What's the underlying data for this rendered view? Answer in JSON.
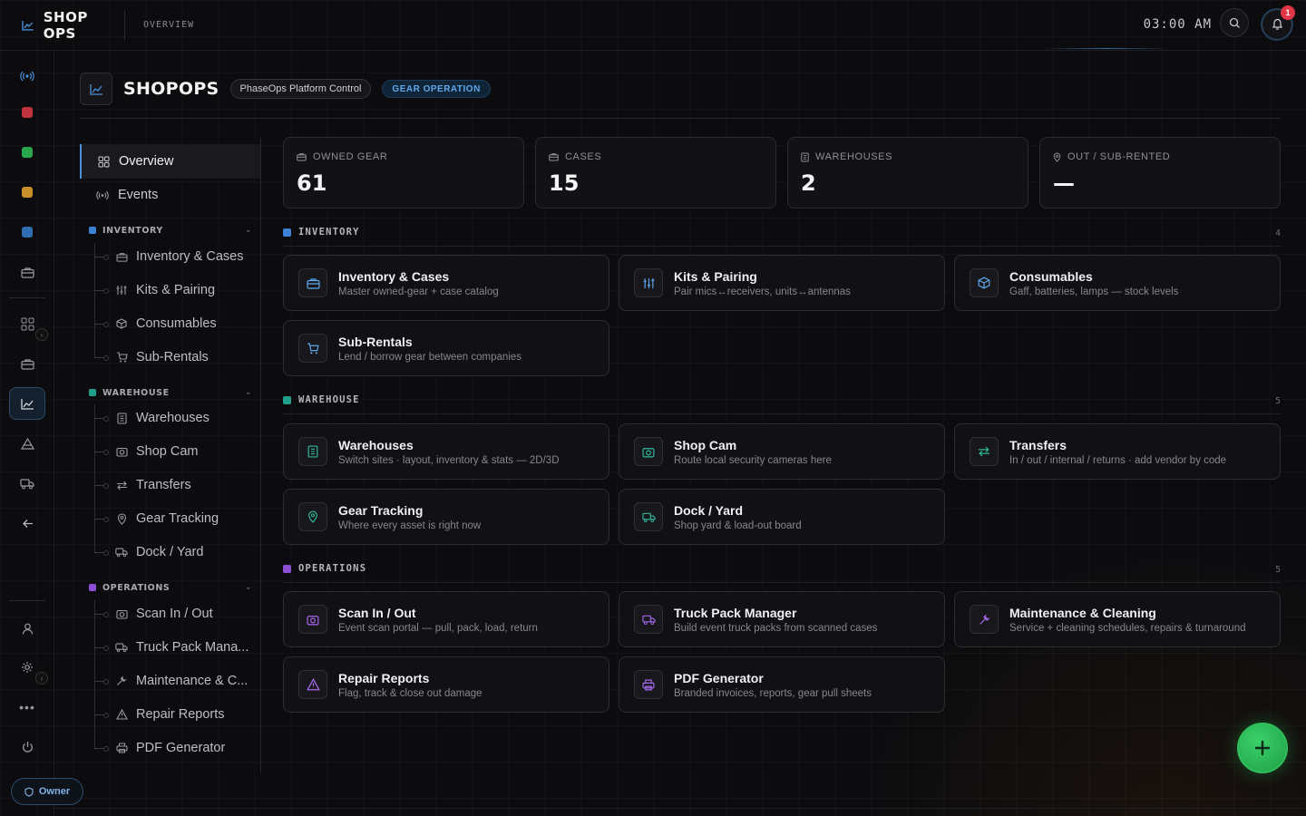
{
  "topbar": {
    "brand": "SHOP OPS",
    "crumb": "OVERVIEW",
    "clock": "03:00 AM",
    "notif_count": "1"
  },
  "rail": {
    "dot_colors": [
      "#c0323e",
      "#2aa64c",
      "#c8902a",
      "#2f6fb0"
    ],
    "owner_label": "Owner"
  },
  "header": {
    "title": "SHOPOPS",
    "platform_pill": "PhaseOps Platform Control",
    "mode_pill": "GEAR OPERATION"
  },
  "subnav": {
    "overview": "Overview",
    "events": "Events",
    "sections": [
      {
        "title": "INVENTORY",
        "color": "#3b82d6",
        "items": [
          "Inventory & Cases",
          "Kits & Pairing",
          "Consumables",
          "Sub-Rentals"
        ]
      },
      {
        "title": "WAREHOUSE",
        "color": "#1fa08a",
        "items": [
          "Warehouses",
          "Shop Cam",
          "Transfers",
          "Gear Tracking",
          "Dock / Yard"
        ]
      },
      {
        "title": "OPERATIONS",
        "color": "#8d4fd6",
        "items": [
          "Scan In / Out",
          "Truck Pack Mana...",
          "Maintenance & C...",
          "Repair Reports",
          "PDF Generator"
        ]
      }
    ]
  },
  "stats": [
    {
      "label": "OWNED GEAR",
      "value": "61"
    },
    {
      "label": "CASES",
      "value": "15"
    },
    {
      "label": "WAREHOUSES",
      "value": "2"
    },
    {
      "label": "OUT / SUB-RENTED",
      "value": "—"
    }
  ],
  "sections": [
    {
      "title": "INVENTORY",
      "count": "4",
      "color": "#3b82d6",
      "cards": [
        {
          "title": "Inventory & Cases",
          "sub": "Master owned-gear + case catalog"
        },
        {
          "title": "Kits & Pairing",
          "sub": "Pair mics↔receivers, units↔antennas"
        },
        {
          "title": "Consumables",
          "sub": "Gaff, batteries, lamps — stock levels"
        },
        {
          "title": "Sub-Rentals",
          "sub": "Lend / borrow gear between companies"
        }
      ]
    },
    {
      "title": "WAREHOUSE",
      "count": "5",
      "color": "#1fa08a",
      "cards": [
        {
          "title": "Warehouses",
          "sub": "Switch sites · layout, inventory & stats — 2D/3D"
        },
        {
          "title": "Shop Cam",
          "sub": "Route local security cameras here"
        },
        {
          "title": "Transfers",
          "sub": "In / out / internal / returns · add vendor by code"
        },
        {
          "title": "Gear Tracking",
          "sub": "Where every asset is right now"
        },
        {
          "title": "Dock / Yard",
          "sub": "Shop yard & load-out board"
        }
      ]
    },
    {
      "title": "OPERATIONS",
      "count": "5",
      "color": "#8d4fd6",
      "cards": [
        {
          "title": "Scan In / Out",
          "sub": "Event scan portal — pull, pack, load, return"
        },
        {
          "title": "Truck Pack Manager",
          "sub": "Build event truck packs from scanned cases"
        },
        {
          "title": "Maintenance & Cleaning",
          "sub": "Service + cleaning schedules, repairs & turnaround"
        },
        {
          "title": "Repair Reports",
          "sub": "Flag, track & close out damage"
        },
        {
          "title": "PDF Generator",
          "sub": "Branded invoices, reports, gear pull sheets"
        }
      ]
    }
  ]
}
